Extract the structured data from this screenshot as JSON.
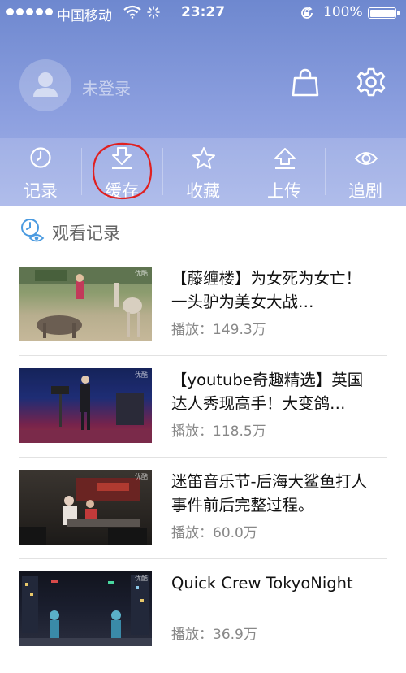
{
  "status_bar": {
    "carrier": "中国移动",
    "time": "23:27",
    "battery": "100%"
  },
  "user": {
    "login_status": "未登录"
  },
  "tabs": [
    {
      "label": "记录",
      "icon": "clock-icon"
    },
    {
      "label": "缓存",
      "icon": "download-icon"
    },
    {
      "label": "收藏",
      "icon": "star-icon"
    },
    {
      "label": "上传",
      "icon": "upload-icon"
    },
    {
      "label": "追剧",
      "icon": "eye-icon"
    }
  ],
  "section": {
    "title": "观看记录",
    "icon": "history-eye-icon"
  },
  "videos": [
    {
      "title": "【藤缠楼】为女死为女亡！一头驴为美女大战…",
      "plays": "播放：149.3万",
      "brand": "优酷"
    },
    {
      "title": "【youtube奇趣精选】英国达人秀现高手！大变鸽…",
      "plays": "播放：118.5万",
      "brand": "优酷"
    },
    {
      "title": "迷笛音乐节-后海大鲨鱼打人事件前后完整过程。",
      "plays": "播放：60.0万",
      "brand": "优酷"
    },
    {
      "title": "Quick Crew TokyoNight",
      "plays": "播放：36.9万",
      "brand": "优酷"
    }
  ],
  "colors": {
    "header_top": "#6e88cf",
    "header_bottom": "#a3b2e8",
    "annotation_circle": "#e02020"
  }
}
